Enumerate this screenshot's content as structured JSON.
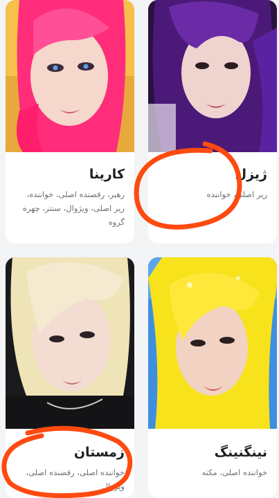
{
  "members": [
    {
      "name": "کارینا",
      "roles": "رهبر، رقصنده اصلی، خواننده، ریر اصلی، ویژوال، سنتر، چهره گروه",
      "hair_color": "#ff2d7a",
      "image_alt": "portrait-pink-hair"
    },
    {
      "name": "ژیزل",
      "roles": "ریر اصلی، خواننده",
      "hair_color": "#4b1a78",
      "image_alt": "portrait-purple-hair"
    },
    {
      "name": "زمستان",
      "roles": "خواننده اصلی، رقصنده اصلی، ویژوال",
      "hair_color": "#efe3b8",
      "image_alt": "portrait-platinum-hair"
    },
    {
      "name": "نینگنینگ",
      "roles": "خواننده اصلی، مکنه",
      "hair_color": "#f7e21c",
      "image_alt": "portrait-yellow-hair"
    }
  ],
  "annotation_color": "#ff4a10"
}
